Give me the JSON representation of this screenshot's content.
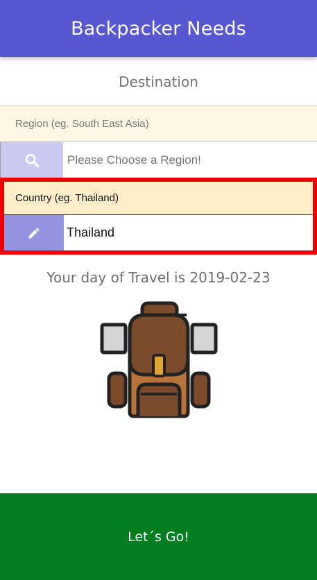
{
  "app": {
    "title": "Backpacker Needs"
  },
  "destination": {
    "heading": "Destination",
    "region": {
      "label": "Region (eg. South East Asia)",
      "placeholder": "Please Choose a Region!",
      "value": "",
      "icon": "search-icon"
    },
    "country": {
      "label": "Country (eg. Thailand)",
      "value": "Thailand",
      "icon": "pencil-icon"
    }
  },
  "travel": {
    "day_text": "Your day of Travel is 2019-02-23"
  },
  "actions": {
    "go_label": "Let´s Go!"
  },
  "colors": {
    "appbar": "#5757d2",
    "region_label_bg": "#fef6e3",
    "country_label_bg": "#fdedc8",
    "search_icon_bg": "#cacaf1",
    "pencil_icon_bg": "#9393e0",
    "highlight_border": "#ee0000",
    "cta": "#017f20"
  }
}
